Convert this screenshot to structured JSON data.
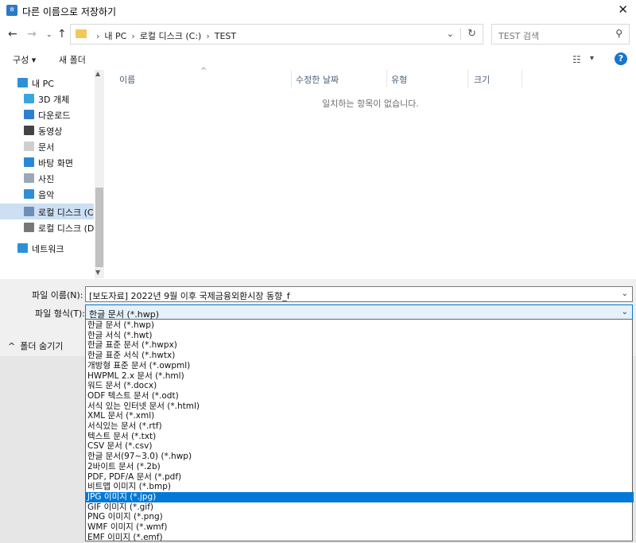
{
  "window": {
    "title": "다른 이름으로 저장하기",
    "icon": "hwp-app-icon"
  },
  "address": {
    "crumbs": [
      "내 PC",
      "로컬 디스크 (C:)",
      "TEST"
    ]
  },
  "search": {
    "placeholder": "TEST 검색"
  },
  "toolbar": {
    "organize": "구성 ▾",
    "new_folder": "새 폴더"
  },
  "nav_items": [
    {
      "label": "내 PC",
      "icon": "pc-icon",
      "color": "#2f8fd6"
    },
    {
      "label": "3D 개체",
      "icon": "3d-objects-icon",
      "color": "#3aa5e0"
    },
    {
      "label": "다운로드",
      "icon": "download-icon",
      "color": "#2f7fd1"
    },
    {
      "label": "동영상",
      "icon": "video-icon",
      "color": "#444444"
    },
    {
      "label": "문서",
      "icon": "document-icon",
      "color": "#cfcfcf"
    },
    {
      "label": "바탕 화면",
      "icon": "desktop-icon",
      "color": "#2a88d8"
    },
    {
      "label": "사진",
      "icon": "picture-icon",
      "color": "#9aa8b8"
    },
    {
      "label": "음악",
      "icon": "music-icon",
      "color": "#2f8fd6"
    },
    {
      "label": "로컬 디스크 (C:)",
      "icon": "drive-c-icon",
      "color": "#6c8fb3",
      "selected": true
    },
    {
      "label": "로컬 디스크 (D:)",
      "icon": "drive-d-icon",
      "color": "#777777"
    },
    {
      "label": "네트워크",
      "icon": "network-icon",
      "color": "#2f8fd6"
    }
  ],
  "columns": [
    "이름",
    "수정한 날짜",
    "유형",
    "크기"
  ],
  "empty_message": "일치하는 항목이 없습니다.",
  "filename": {
    "label": "파일 이름(N):",
    "value": "[보도자료] 2022년 9월 이후 국제금융외환시장 동향_f"
  },
  "filetype": {
    "label": "파일 형식(T):",
    "value": "한글 문서 (*.hwp)"
  },
  "hide_folders": "폴더 숨기기",
  "filetype_options": [
    "한글 문서 (*.hwp)",
    "한글 서식 (*.hwt)",
    "한글 표준 문서 (*.hwpx)",
    "한글 표준 서식 (*.hwtx)",
    "개방형 표준 문서 (*.owpml)",
    "HWPML 2.x 문서 (*.hml)",
    "워드 문서 (*.docx)",
    "ODF 텍스트 문서 (*.odt)",
    "서식 있는 인터넷 문서 (*.html)",
    "XML 문서 (*.xml)",
    "서식있는 문서 (*.rtf)",
    "텍스트 문서 (*.txt)",
    "CSV 문서 (*.csv)",
    "한글 문서(97~3.0) (*.hwp)",
    "2바이트 문서 (*.2b)",
    "PDF, PDF/A 문서 (*.pdf)",
    "비트맵 이미지 (*.bmp)",
    "JPG 이미지 (*.jpg)",
    "GIF 이미지 (*.gif)",
    "PNG 이미지 (*.png)",
    "WMF 이미지 (*.wmf)",
    "EMF 이미지 (*.emf)"
  ],
  "selected_option": 17
}
